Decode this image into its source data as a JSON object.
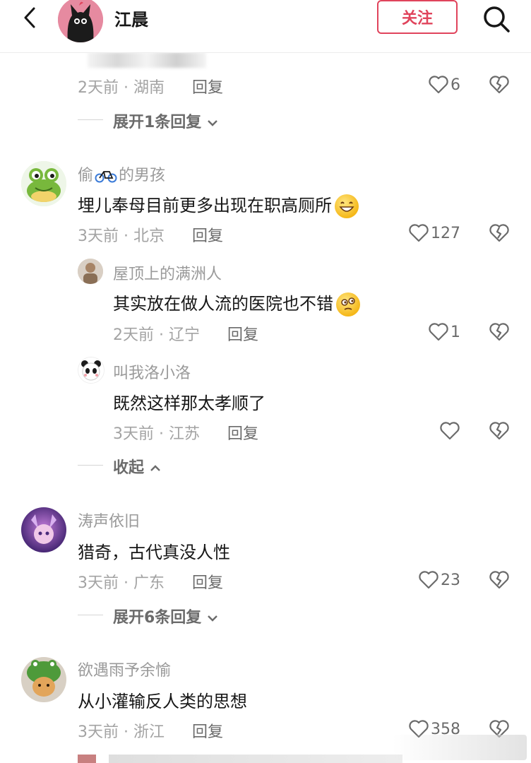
{
  "header": {
    "title": "江晨",
    "follow_label": "关注",
    "back_icon": "chevron-left-icon",
    "search_icon": "search-icon"
  },
  "colors": {
    "accent": "#e0445c",
    "meta": "#a3a3a3",
    "text": "#161616"
  },
  "top_partial": {
    "time_location": "2天前 · 湖南",
    "reply_label": "回复",
    "likes": "6",
    "expand_label": "展开1条回复"
  },
  "comments": [
    {
      "username_pre": "偷",
      "username_post": "的男孩",
      "text": "埋儿奉母目前更多出现在职高厕所",
      "time_location": "3天前 · 北京",
      "reply_label": "回复",
      "likes": "127",
      "replies": [
        {
          "username": "屋顶上的满洲人",
          "text": "其实放在做人流的医院也不错",
          "time_location": "2天前 · 辽宁",
          "reply_label": "回复",
          "likes": "1"
        },
        {
          "username": "叫我洛小洛",
          "text": "既然这样那太孝顺了",
          "time_location": "3天前 · 江苏",
          "reply_label": "回复",
          "likes": ""
        }
      ],
      "collapse_label": "收起"
    },
    {
      "username": "涛声依旧",
      "text": "猎奇，古代真没人性",
      "time_location": "3天前 · 广东",
      "reply_label": "回复",
      "likes": "23",
      "expand_label": "展开6条回复"
    },
    {
      "username": "欲遇雨予余愉",
      "text": "从小灌输反人类的思想",
      "time_location": "3天前 · 浙江",
      "reply_label": "回复",
      "likes": "358"
    }
  ]
}
